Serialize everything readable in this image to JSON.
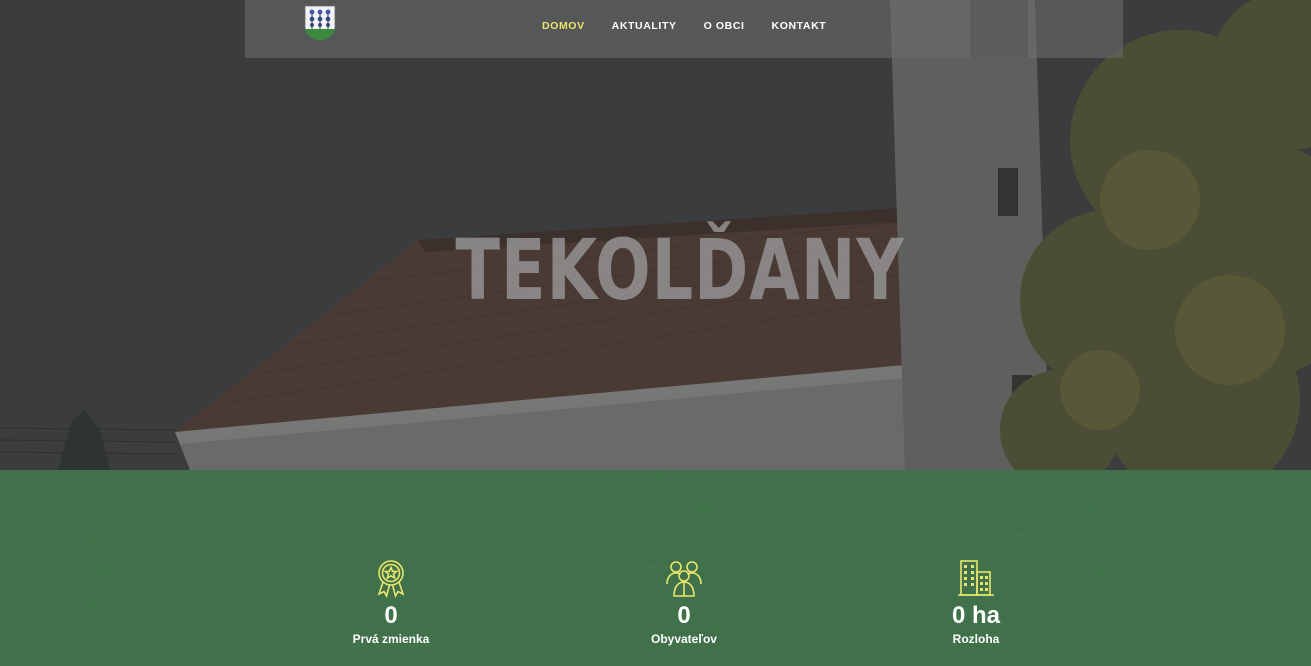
{
  "site": {
    "logo_icon": "village-coat-of-arms-icon"
  },
  "nav": {
    "items": [
      {
        "label": "DOMOV",
        "active": true
      },
      {
        "label": "AKTUALITY",
        "active": false
      },
      {
        "label": "O OBCI",
        "active": false
      },
      {
        "label": "KONTAKT",
        "active": false
      }
    ],
    "active_color": "#e9e56a"
  },
  "hero": {
    "title": "TEKOLĎANY"
  },
  "stats": {
    "background_color": "#40714a",
    "icon_color": "#e9e56a",
    "items": [
      {
        "icon": "award-ribbon-icon",
        "value": "0",
        "label": "Prvá zmienka"
      },
      {
        "icon": "people-group-icon",
        "value": "0",
        "label": "Obyvateľov"
      },
      {
        "icon": "buildings-icon",
        "value": "0 ha",
        "label": "Rozloha"
      }
    ]
  }
}
